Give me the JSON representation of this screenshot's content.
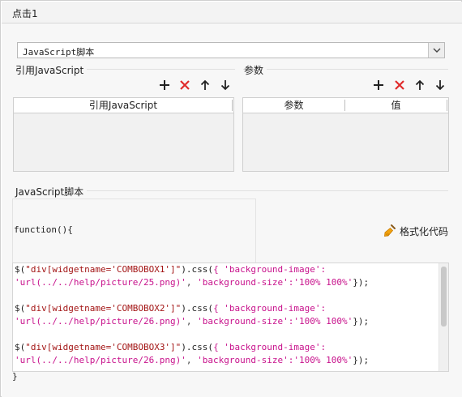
{
  "window": {
    "title": "点击1"
  },
  "script_type_select": {
    "value": "JavaScript脚本"
  },
  "reference_js": {
    "label": "引用JavaScript",
    "table": {
      "columns": [
        "引用JavaScript"
      ],
      "rows": []
    }
  },
  "params": {
    "label": "参数",
    "table": {
      "columns": [
        "参数",
        "值"
      ],
      "rows": []
    }
  },
  "toolbar": {
    "icons": [
      "plus-icon",
      "delete-x-icon",
      "arrow-up-icon",
      "arrow-down-icon"
    ],
    "colors": {
      "add": "#222222",
      "delete": "#e02b2b",
      "move": "#222222"
    }
  },
  "script": {
    "label": "JavaScript脚本",
    "function_open": "function(){",
    "function_close": "}",
    "format_button": "格式化代码",
    "code_lines": [
      [
        [
          "c-k",
          "$("
        ],
        [
          "c-s",
          "\"div[widgetname='COMBOBOX1']\""
        ],
        [
          "c-k",
          ").css("
        ],
        [
          "c-p",
          "{ 'background-image':"
        ]
      ],
      [
        [
          "c-p",
          "'url(../../help/picture/25.png)'"
        ],
        [
          "c-m",
          ", "
        ],
        [
          "c-p",
          "'background-size':'100% 100%'"
        ],
        [
          "c-k",
          "});"
        ]
      ],
      [],
      [
        [
          "c-k",
          "$("
        ],
        [
          "c-s",
          "\"div[widgetname='COMBOBOX2']\""
        ],
        [
          "c-k",
          ").css("
        ],
        [
          "c-p",
          "{ 'background-image':"
        ]
      ],
      [
        [
          "c-p",
          "'url(../../help/picture/26.png)'"
        ],
        [
          "c-m",
          ", "
        ],
        [
          "c-p",
          "'background-size':'100% 100%'"
        ],
        [
          "c-k",
          "});"
        ]
      ],
      [],
      [
        [
          "c-k",
          "$("
        ],
        [
          "c-s",
          "\"div[widgetname='COMBOBOX3']\""
        ],
        [
          "c-k",
          ").css("
        ],
        [
          "c-p",
          "{ 'background-image':"
        ]
      ],
      [
        [
          "c-p",
          "'url(../../help/picture/26.png)'"
        ],
        [
          "c-m",
          ", "
        ],
        [
          "c-p",
          "'background-size':'100% 100%'"
        ],
        [
          "c-k",
          "});"
        ]
      ]
    ]
  }
}
